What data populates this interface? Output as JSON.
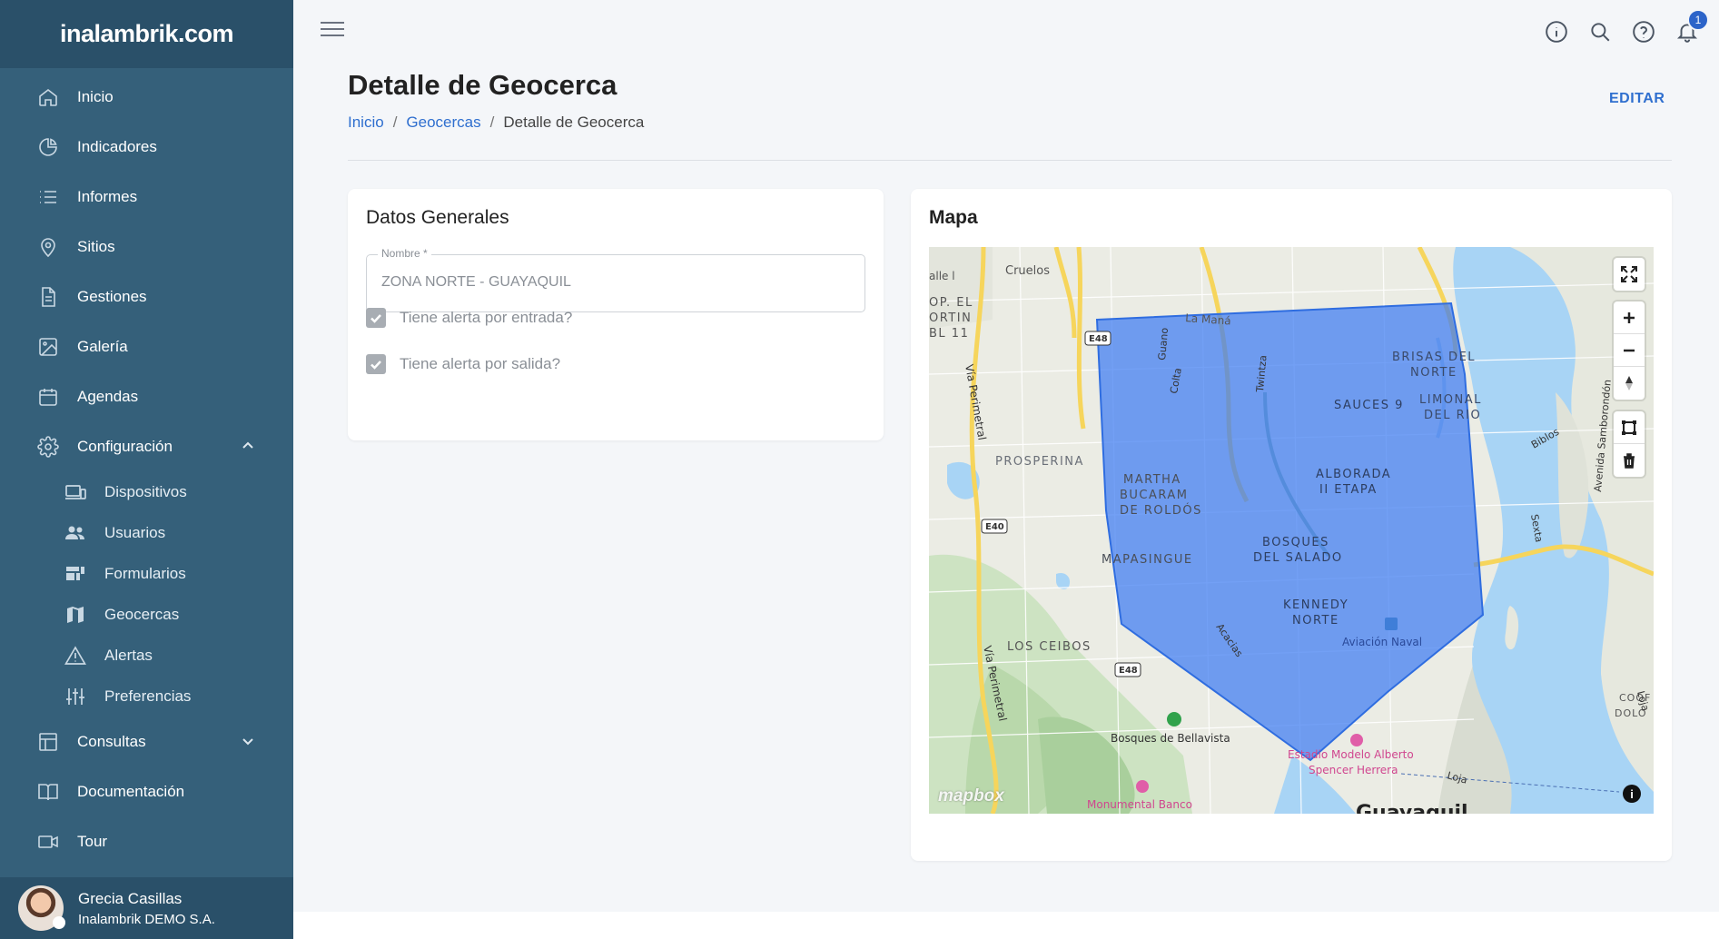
{
  "brand": {
    "name": "inalambrik.com"
  },
  "sidebar": {
    "items": [
      {
        "label": "Inicio",
        "icon": "home-icon"
      },
      {
        "label": "Indicadores",
        "icon": "pie-chart-icon"
      },
      {
        "label": "Informes",
        "icon": "list-icon"
      },
      {
        "label": "Sitios",
        "icon": "map-pin-icon"
      },
      {
        "label": "Gestiones",
        "icon": "document-icon"
      },
      {
        "label": "Galería",
        "icon": "image-icon"
      },
      {
        "label": "Agendas",
        "icon": "calendar-icon"
      },
      {
        "label": "Configuración",
        "icon": "gear-icon"
      }
    ],
    "config_sub": [
      {
        "label": "Dispositivos",
        "icon": "devices-icon"
      },
      {
        "label": "Usuarios",
        "icon": "people-icon"
      },
      {
        "label": "Formularios",
        "icon": "forms-icon"
      },
      {
        "label": "Geocercas",
        "icon": "map-icon"
      },
      {
        "label": "Alertas",
        "icon": "warning-icon"
      },
      {
        "label": "Preferencias",
        "icon": "sliders-icon"
      }
    ],
    "bottom_items": [
      {
        "label": "Consultas",
        "icon": "table-icon"
      },
      {
        "label": "Documentación",
        "icon": "book-icon"
      },
      {
        "label": "Tour",
        "icon": "video-icon"
      }
    ],
    "user": {
      "name": "Grecia Casillas",
      "org": "Inalambrik DEMO S.A."
    }
  },
  "topbar": {
    "notifications": "1"
  },
  "page": {
    "title": "Detalle de Geocerca",
    "breadcrumb": [
      "Inicio",
      "Geocercas",
      "Detalle de Geocerca"
    ],
    "edit_label": "EDITAR"
  },
  "general": {
    "title": "Datos Generales",
    "name_label": "Nombre *",
    "name_value": "ZONA NORTE - GUAYAQUIL",
    "alert_entry_label": "Tiene alerta por entrada?",
    "alert_entry_checked": true,
    "alert_exit_label": "Tiene alerta por salida?",
    "alert_exit_checked": true
  },
  "map": {
    "title": "Mapa",
    "attribution": "mapbox",
    "labels": {
      "cruelos": "Cruelos",
      "la_mana": "La Maná",
      "prosperina": "PROSPERINA",
      "martha_1": "MARTHA",
      "martha_2": "BUCARAM",
      "martha_3": "DE ROLDÓS",
      "mapasingue": "MAPASINGUE",
      "los_ceibos": "LOS CEIBOS",
      "bosques": "Bosques de Bellavista",
      "brisas_1": "BRISAS DEL",
      "brisas_2": "NORTE",
      "sauces": "SAUCES 9",
      "limonal_1": "LIMONAL",
      "limonal_2": "DEL RIO",
      "alborada_1": "ALBORADA",
      "alborada_2": "II ETAPA",
      "salado_1": "BOSQUES",
      "salado_2": "DEL SALADO",
      "kennedy_1": "KENNEDY",
      "kennedy_2": "NORTE",
      "aviacion": "Aviación Naval",
      "estadio_1": "Estadio Modelo Alberto",
      "estadio_2": "Spencer Herrera",
      "monumental": "Monumental Banco",
      "guayaquil": "Guayaquil",
      "via_perimetral": "Vía Perimetral",
      "twintza": "Twintza",
      "guano": "Guano",
      "colta": "Colta",
      "acacias": "Acacias",
      "samborondon": "Avenida Samborondón",
      "biblos": "Biblos",
      "sexta": "Sexta",
      "loja": "Loja",
      "e48": "E48",
      "e40": "E40",
      "alle": "alle l",
      "op_el_1": "OP. EL",
      "op_el_2": "ORTIN",
      "op_el_3": "BL 11",
      "coop_1": "COOF",
      "coop_2": "DOLO",
      "loja2": "Loja"
    },
    "colors": {
      "polygon_fill": "#3d7cf2",
      "water": "#a8d4f5",
      "road": "#f6d55c"
    }
  }
}
